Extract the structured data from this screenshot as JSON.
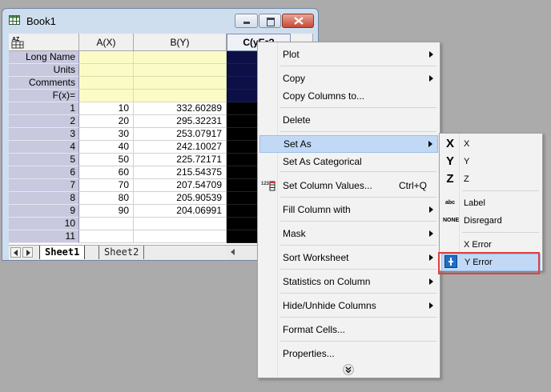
{
  "window": {
    "title": "Book1"
  },
  "columns": [
    {
      "name": "A(X)"
    },
    {
      "name": "B(Y)"
    },
    {
      "name": "C(yEr?"
    }
  ],
  "label_rows": [
    "Long Name",
    "Units",
    "Comments",
    "F(x)="
  ],
  "rows": [
    {
      "n": "1",
      "a": "10",
      "b": "332.60289"
    },
    {
      "n": "2",
      "a": "20",
      "b": "295.32231"
    },
    {
      "n": "3",
      "a": "30",
      "b": "253.07917"
    },
    {
      "n": "4",
      "a": "40",
      "b": "242.10027"
    },
    {
      "n": "5",
      "a": "50",
      "b": "225.72171"
    },
    {
      "n": "6",
      "a": "60",
      "b": "215.54375"
    },
    {
      "n": "7",
      "a": "70",
      "b": "207.54709"
    },
    {
      "n": "8",
      "a": "80",
      "b": "205.90539"
    },
    {
      "n": "9",
      "a": "90",
      "b": "204.06991"
    },
    {
      "n": "10",
      "a": "",
      "b": ""
    },
    {
      "n": "11",
      "a": "",
      "b": ""
    }
  ],
  "tabs": [
    "Sheet1",
    "Sheet2"
  ],
  "context_menu": {
    "items": [
      {
        "label": "Plot",
        "submenu": true
      },
      {
        "label": "Copy",
        "submenu": true
      },
      {
        "label": "Copy Columns to...",
        "submenu": false
      },
      {
        "label": "Delete",
        "submenu": false
      },
      {
        "label": "Set As",
        "submenu": true,
        "highlighted": true
      },
      {
        "label": "Set As Categorical",
        "submenu": false
      },
      {
        "label": "Set Column Values...",
        "shortcut": "Ctrl+Q",
        "icon": "set-column-values-icon"
      },
      {
        "label": "Fill Column with",
        "submenu": true
      },
      {
        "label": "Mask",
        "submenu": true
      },
      {
        "label": "Sort Worksheet",
        "submenu": true
      },
      {
        "label": "Statistics on Column",
        "submenu": true
      },
      {
        "label": "Hide/Unhide Columns",
        "submenu": true
      },
      {
        "label": "Format Cells...",
        "submenu": false
      },
      {
        "label": "Properties...",
        "submenu": false
      }
    ]
  },
  "set_as_submenu": {
    "items": [
      {
        "label": "X",
        "icon": "x-designation-icon",
        "glyph": "X"
      },
      {
        "label": "Y",
        "icon": "y-designation-icon",
        "glyph": "Y"
      },
      {
        "label": "Z",
        "icon": "z-designation-icon",
        "glyph": "Z"
      },
      {
        "label": "Label",
        "icon": "label-designation-icon",
        "glyph": "abc"
      },
      {
        "label": "Disregard",
        "icon": "disregard-designation-icon",
        "glyph": "NONE"
      },
      {
        "label": "X Error",
        "icon": ""
      },
      {
        "label": "Y Error",
        "icon": "y-error-icon",
        "highlighted": true
      }
    ]
  },
  "colors": {
    "highlight": "#c1d9f5",
    "annotation_box": "#e04040",
    "meta_rows": "#fbfbc6",
    "row_header": "#c8c8de",
    "selected_column": "#000000"
  }
}
